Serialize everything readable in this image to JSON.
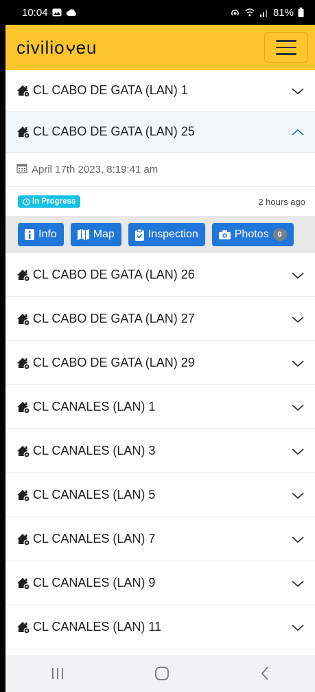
{
  "status_bar": {
    "time": "10:04",
    "battery": "81%"
  },
  "header": {
    "logo_left": "civilio",
    "logo_right": "eu"
  },
  "list": {
    "items_top": [
      {
        "title": "CL CABO DE GATA (LAN) 1"
      },
      {
        "title": "CL CABO DE GATA (LAN) 25"
      }
    ],
    "expanded": {
      "date": "April 17th 2023, 8:19:41 am",
      "status": "In Progress",
      "ago": "2 hours ago",
      "buttons": {
        "info": "Info",
        "map": "Map",
        "inspection": "Inspection",
        "photos": "Photos",
        "photos_count": "0"
      }
    },
    "items_bottom": [
      {
        "title": "CL CABO DE GATA (LAN) 26"
      },
      {
        "title": "CL CABO DE GATA (LAN) 27"
      },
      {
        "title": "CL CABO DE GATA (LAN) 29"
      },
      {
        "title": "CL CANALES (LAN) 1"
      },
      {
        "title": "CL CANALES (LAN) 3"
      },
      {
        "title": "CL CANALES (LAN) 5"
      },
      {
        "title": "CL CANALES (LAN) 7"
      },
      {
        "title": "CL CANALES (LAN) 9"
      },
      {
        "title": "CL CANALES (LAN) 11"
      }
    ]
  },
  "colors": {
    "header": "#fbc52b",
    "button": "#2176d9",
    "badge": "#17c1e3"
  }
}
